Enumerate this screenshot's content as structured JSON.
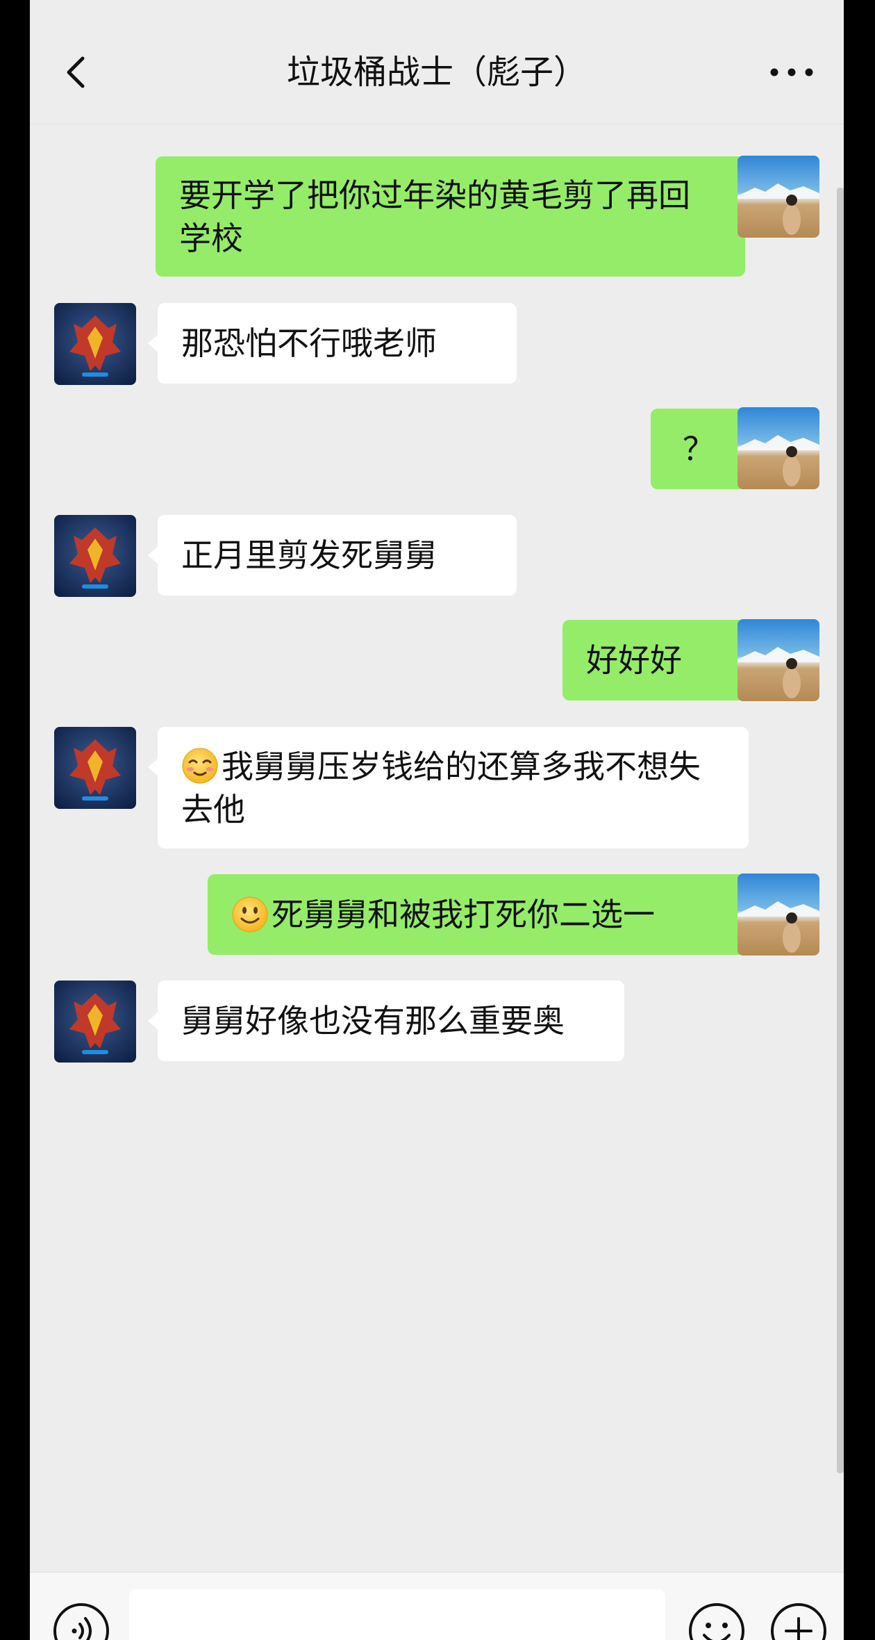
{
  "header": {
    "title": "垃圾桶战士（彪子）",
    "back_icon": "chevron-left-icon",
    "more_icon": "more-dots-icon"
  },
  "messages": [
    {
      "side": "out",
      "text": "要开学了把你过年染的黄毛剪了再回学校"
    },
    {
      "side": "in",
      "text": "那恐怕不行哦老师"
    },
    {
      "side": "out",
      "text": "？"
    },
    {
      "side": "in",
      "text": "正月里剪发死舅舅"
    },
    {
      "side": "out",
      "text": "好好好"
    },
    {
      "side": "in",
      "emoji": "relieved-emoji",
      "text": "我舅舅压岁钱给的还算多我不想失去他"
    },
    {
      "side": "out",
      "emoji": "smile-emoji",
      "text": "死舅舅和被我打死你二选一"
    },
    {
      "side": "in",
      "text": "舅舅好像也没有那么重要奥"
    }
  ],
  "input_bar": {
    "voice_icon": "voice-icon",
    "emoji_icon": "emoji-icon",
    "plus_icon": "plus-icon",
    "input_value": ""
  },
  "colors": {
    "background": "#ededed",
    "outgoing_bubble": "#95ec69",
    "incoming_bubble": "#ffffff"
  }
}
